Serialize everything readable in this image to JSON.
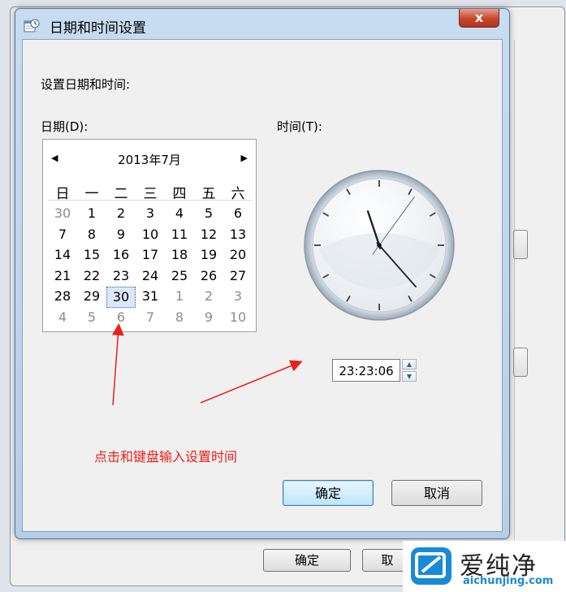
{
  "background_window": {
    "ok_label": "确定",
    "cancel_label": "取"
  },
  "dialog": {
    "title": "日期和时间设置",
    "close_glyph": "x",
    "heading": "设置日期和时间:",
    "date_label": "日期(D):",
    "time_label": "时间(T):",
    "ok_label": "确定",
    "cancel_label": "取消"
  },
  "calendar": {
    "month_title": "2013年7月",
    "prev_icon": "triangle-left-icon",
    "next_icon": "triangle-right-icon",
    "weekdays": [
      "日",
      "一",
      "二",
      "三",
      "四",
      "五",
      "六"
    ],
    "weeks": [
      [
        "30",
        "1",
        "2",
        "3",
        "4",
        "5",
        "6"
      ],
      [
        "7",
        "8",
        "9",
        "10",
        "11",
        "12",
        "13"
      ],
      [
        "14",
        "15",
        "16",
        "17",
        "18",
        "19",
        "20"
      ],
      [
        "21",
        "22",
        "23",
        "24",
        "25",
        "26",
        "27"
      ],
      [
        "28",
        "29",
        "30",
        "31",
        "1",
        "2",
        "3"
      ],
      [
        "4",
        "5",
        "6",
        "7",
        "8",
        "9",
        "10"
      ]
    ],
    "selected_day": "30"
  },
  "clock": {
    "hour": 23,
    "minute": 23,
    "second": 6
  },
  "time_input": {
    "value": "23:23:06"
  },
  "annotation": {
    "text": "点击和键盘输入设置时间",
    "color": "#e8201a"
  },
  "watermark": {
    "brand": "爱纯净",
    "domain": "aichunjing.com"
  }
}
